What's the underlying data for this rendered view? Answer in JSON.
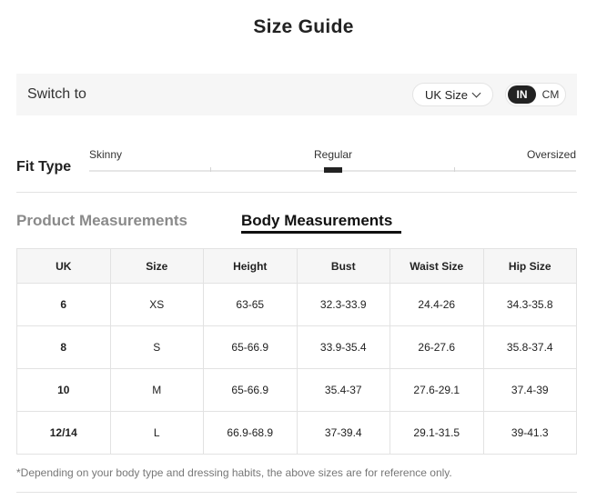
{
  "title": "Size Guide",
  "switch": {
    "label": "Switch to",
    "size_system": "UK Size",
    "units": {
      "in": "IN",
      "cm": "CM",
      "selected": "IN"
    }
  },
  "fit": {
    "label": "Fit Type",
    "options": [
      "Skinny",
      "Regular",
      "Oversized"
    ],
    "selected": "Regular"
  },
  "tabs": {
    "product": "Product Measurements",
    "body": "Body Measurements",
    "active": "Body Measurements"
  },
  "table": {
    "headers": [
      "UK",
      "Size",
      "Height",
      "Bust",
      "Waist Size",
      "Hip Size"
    ],
    "rows": [
      [
        "6",
        "XS",
        "63-65",
        "32.3-33.9",
        "24.4-26",
        "34.3-35.8"
      ],
      [
        "8",
        "S",
        "65-66.9",
        "33.9-35.4",
        "26-27.6",
        "35.8-37.4"
      ],
      [
        "10",
        "M",
        "65-66.9",
        "35.4-37",
        "27.6-29.1",
        "37.4-39"
      ],
      [
        "12/14",
        "L",
        "66.9-68.9",
        "37-39.4",
        "29.1-31.5",
        "39-41.3"
      ]
    ]
  },
  "footnote": "*Depending on your body type and dressing habits, the above sizes are for reference only.",
  "colors": {
    "accent": "#222222",
    "panel_bg": "#f6f6f6",
    "muted_tab": "#8a8a8a"
  }
}
